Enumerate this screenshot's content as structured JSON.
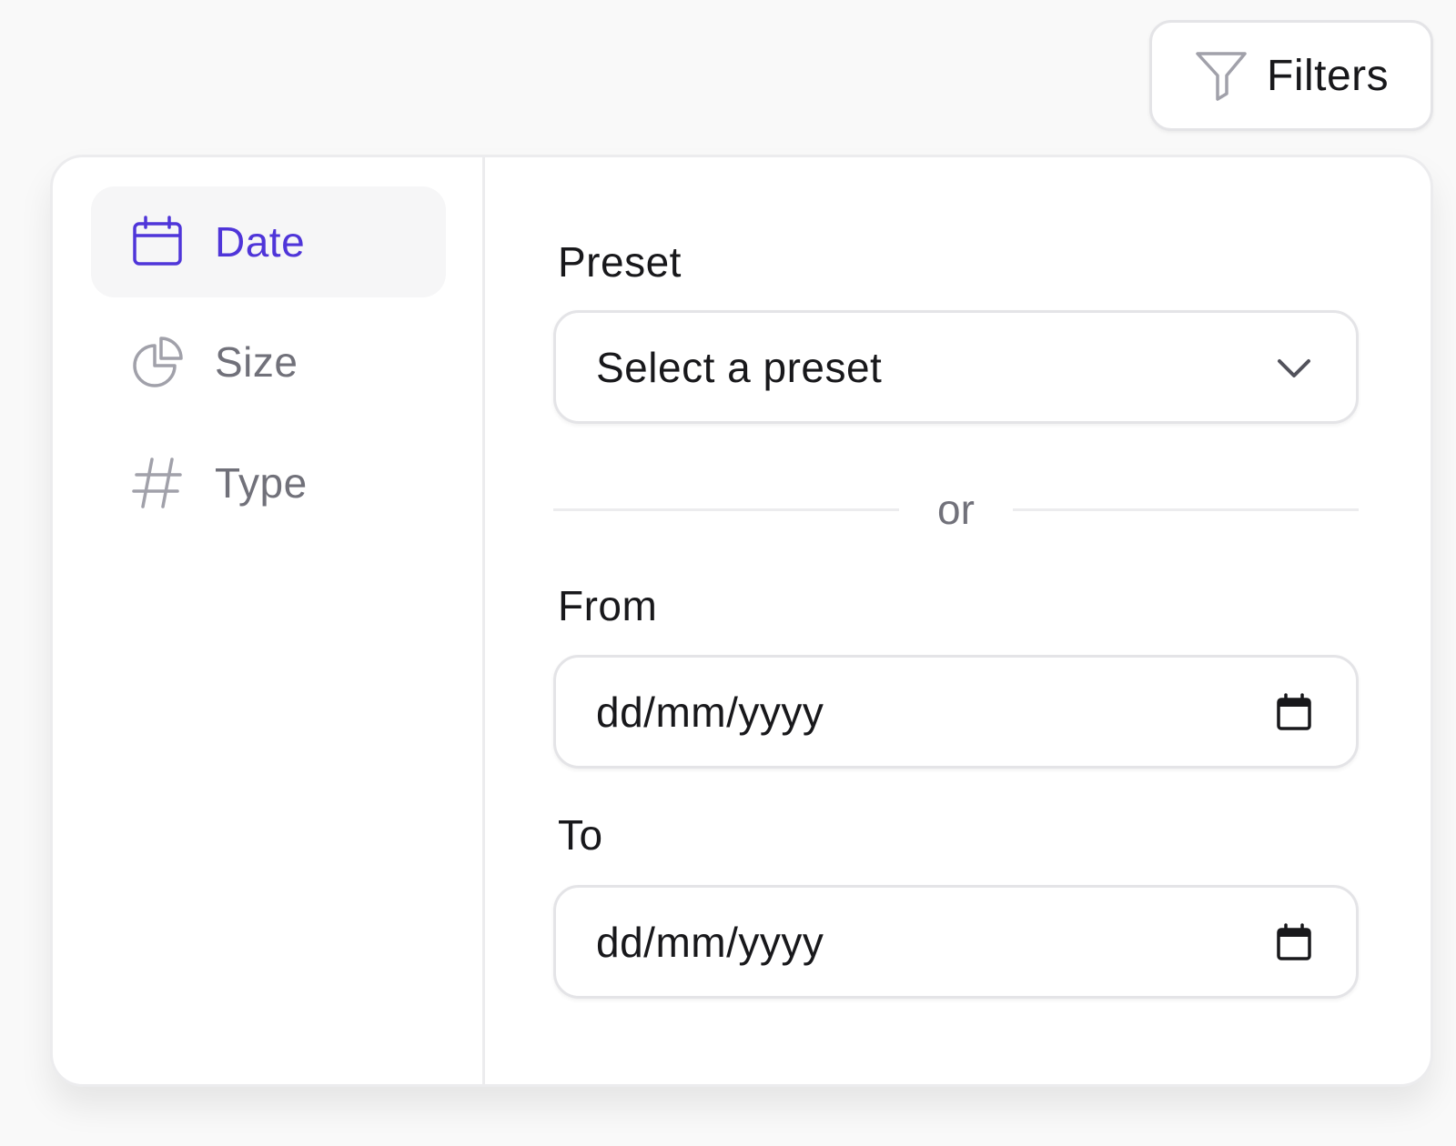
{
  "toolbar": {
    "filters_label": "Filters",
    "filters_icon": "funnel-icon"
  },
  "sidebar": {
    "items": [
      {
        "label": "Date",
        "icon": "calendar-icon",
        "active": true
      },
      {
        "label": "Size",
        "icon": "pie-chart-icon",
        "active": false
      },
      {
        "label": "Type",
        "icon": "hash-icon",
        "active": false
      }
    ]
  },
  "date_filter": {
    "preset_label": "Preset",
    "preset_placeholder": "Select a preset",
    "divider_text": "or",
    "from_label": "From",
    "from_placeholder": "dd/mm/yyyy",
    "to_label": "To",
    "to_placeholder": "dd/mm/yyyy"
  },
  "colors": {
    "accent": "#4f35d9",
    "muted_text": "#71717a",
    "border": "#e4e4e7",
    "background": "#f9f9f9"
  }
}
